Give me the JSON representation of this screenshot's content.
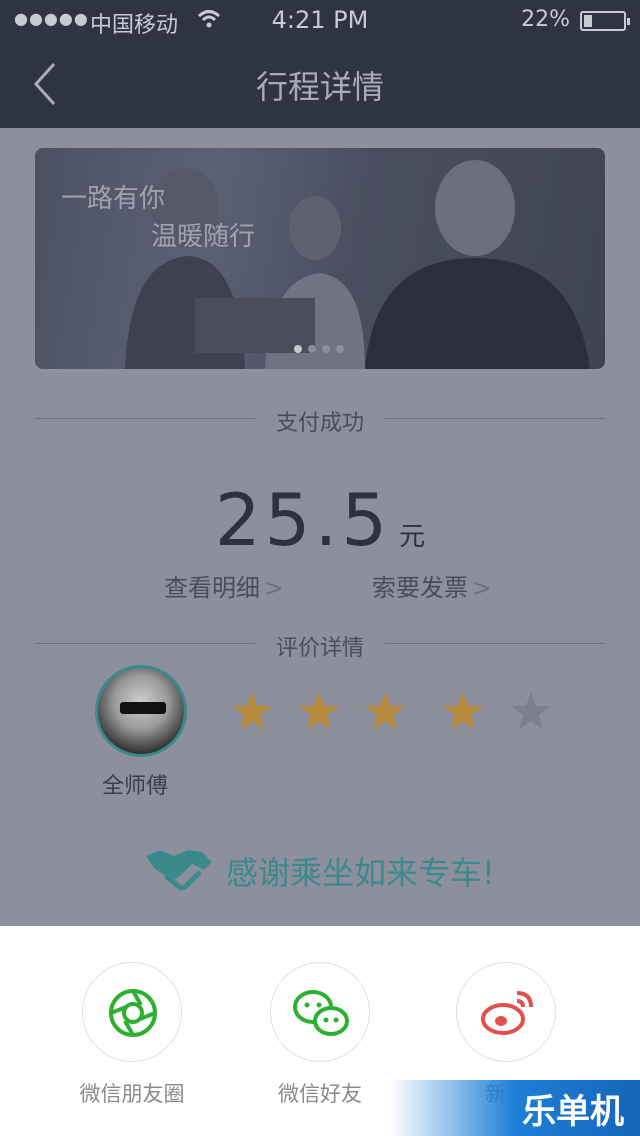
{
  "status_bar": {
    "signal": "●●●●●",
    "carrier": "中国移动",
    "time": "4:21 PM",
    "battery": "22%"
  },
  "nav": {
    "title": "行程详情",
    "back_icon": "chevron-left-icon"
  },
  "banner": {
    "line1": "一路有你",
    "line2": "温暖随行",
    "page_count": 4,
    "active_page": 1
  },
  "payment": {
    "section_title": "支付成功",
    "amount": "25.5",
    "unit": "元",
    "view_details": "查看明细",
    "request_invoice": "索要发票",
    "chevron": ">"
  },
  "rating": {
    "section_title": "评价详情",
    "driver_name": "全师傅",
    "stars_filled": 4,
    "stars_total": 5,
    "star_color": "#b78a3c",
    "star_empty_color": "#7d808c"
  },
  "thanks": {
    "text": "感谢乘坐如来专车!",
    "icon": "handshake-icon",
    "color": "#3a8a8c"
  },
  "share": {
    "items": [
      {
        "label": "微信朋友圈",
        "icon": "wechat-moments-icon",
        "color": "#2bb12f"
      },
      {
        "label": "微信好友",
        "icon": "wechat-icon",
        "color": "#2bb12f"
      },
      {
        "label": "新浪",
        "icon": "weibo-icon",
        "color": "#e0504d"
      }
    ]
  },
  "watermark": "乐单机"
}
